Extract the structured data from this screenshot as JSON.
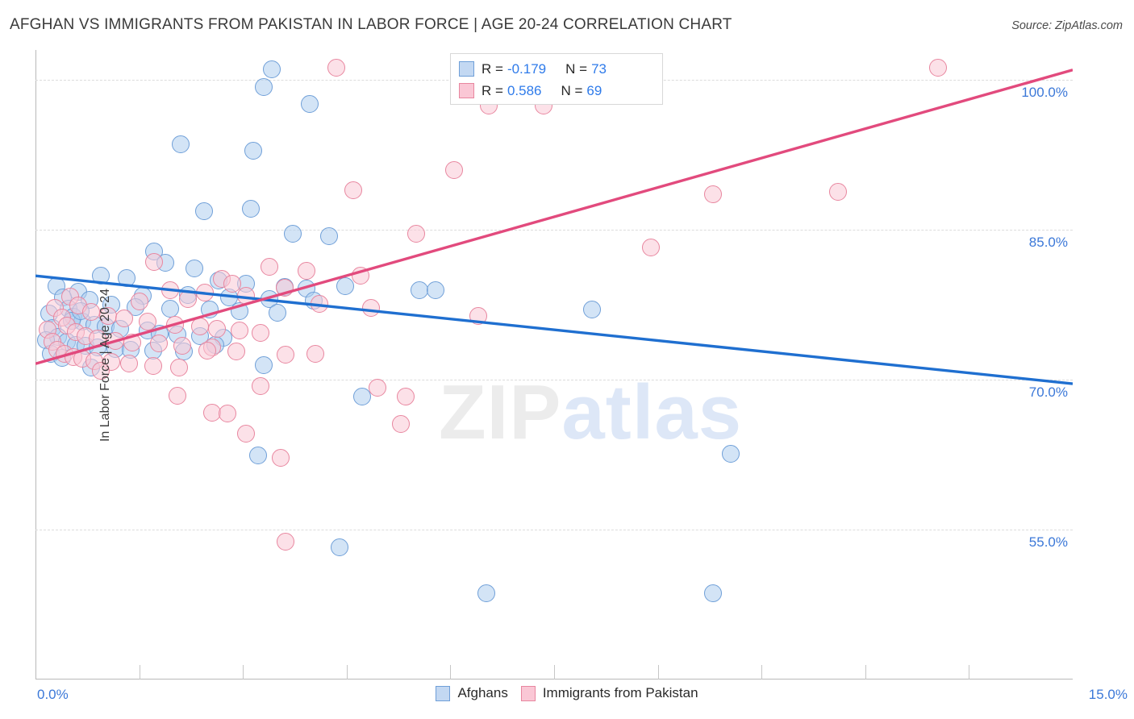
{
  "title": "AFGHAN VS IMMIGRANTS FROM PAKISTAN IN LABOR FORCE | AGE 20-24 CORRELATION CHART",
  "source": "Source: ZipAtlas.com",
  "watermark": {
    "part1": "ZIP",
    "part2": "atlas"
  },
  "colors": {
    "blue_fill": "#afcdee",
    "blue_stroke": "#6f9fd8",
    "pink_fill": "#f9c8d6",
    "pink_stroke": "#e8869f",
    "blue_line": "#1f6fd0",
    "pink_line": "#e24a7d",
    "axis_label": "#3b78d8",
    "grid": "#dcdcdc"
  },
  "stats": [
    {
      "series": "Afghans",
      "swatch": "blue",
      "r_label": "R =",
      "r_value": "-0.179",
      "n_label": "N =",
      "n_value": "73"
    },
    {
      "series": "Immigrants from Pakistan",
      "swatch": "pink",
      "r_label": "R =",
      "r_value": "0.586",
      "n_label": "N =",
      "n_value": "69"
    }
  ],
  "legend": [
    {
      "label": "Afghans",
      "swatch": "blue"
    },
    {
      "label": "Immigrants from Pakistan",
      "swatch": "pink"
    }
  ],
  "chart_data": {
    "type": "scatter",
    "title": "AFGHAN VS IMMIGRANTS FROM PAKISTAN IN LABOR FORCE | AGE 20-24 CORRELATION CHART",
    "xlabel": "",
    "ylabel": "In Labor Force | Age 20-24",
    "xlim": [
      0.0,
      15.0
    ],
    "ylim": [
      40.0,
      103.0
    ],
    "x_tick_labels": [
      "0.0%",
      "15.0%"
    ],
    "y_tick_labels": [
      "100.0%",
      "85.0%",
      "70.0%",
      "55.0%"
    ],
    "y_ticks": [
      100.0,
      85.0,
      70.0,
      55.0
    ],
    "x_ticks_count": 10,
    "grid": "horizontal-dashed",
    "legend_position": "bottom-center",
    "series": [
      {
        "name": "Afghans",
        "color": "#afcdee",
        "stroke": "#6f9fd8",
        "r": -0.179,
        "n": 73,
        "trendline": {
          "x0": 0.0,
          "y0": 80.4,
          "x1": 15.0,
          "y1": 69.6
        },
        "points": [
          [
            3.42,
            101.1
          ],
          [
            8.7,
            101.3
          ],
          [
            3.3,
            99.3
          ],
          [
            3.96,
            97.6
          ],
          [
            2.1,
            93.6
          ],
          [
            3.15,
            92.9
          ],
          [
            2.44,
            86.9
          ],
          [
            3.12,
            87.1
          ],
          [
            3.72,
            84.6
          ],
          [
            4.25,
            84.4
          ],
          [
            1.72,
            82.8
          ],
          [
            1.88,
            81.7
          ],
          [
            2.3,
            81.1
          ],
          [
            0.95,
            80.4
          ],
          [
            1.32,
            80.2
          ],
          [
            2.65,
            79.9
          ],
          [
            3.05,
            79.6
          ],
          [
            3.6,
            79.3
          ],
          [
            3.92,
            79.1
          ],
          [
            4.48,
            79.4
          ],
          [
            5.55,
            79.0
          ],
          [
            5.78,
            79.0
          ],
          [
            1.55,
            78.4
          ],
          [
            2.2,
            78.5
          ],
          [
            2.8,
            78.2
          ],
          [
            3.38,
            78.1
          ],
          [
            4.02,
            77.9
          ],
          [
            0.62,
            78.8
          ],
          [
            0.78,
            78.0
          ],
          [
            1.1,
            77.5
          ],
          [
            1.45,
            77.3
          ],
          [
            1.95,
            77.1
          ],
          [
            2.52,
            77.0
          ],
          [
            2.95,
            76.9
          ],
          [
            3.5,
            76.7
          ],
          [
            8.05,
            77.0
          ],
          [
            0.3,
            79.4
          ],
          [
            0.4,
            78.2
          ],
          [
            0.48,
            77.1
          ],
          [
            0.55,
            76.3
          ],
          [
            0.68,
            75.8
          ],
          [
            0.85,
            75.5
          ],
          [
            1.02,
            75.3
          ],
          [
            1.22,
            75.1
          ],
          [
            1.62,
            74.9
          ],
          [
            1.8,
            74.6
          ],
          [
            2.05,
            74.5
          ],
          [
            2.38,
            74.4
          ],
          [
            2.72,
            74.2
          ],
          [
            0.2,
            76.6
          ],
          [
            0.25,
            75.2
          ],
          [
            0.33,
            74.3
          ],
          [
            0.45,
            73.8
          ],
          [
            0.58,
            73.5
          ],
          [
            0.72,
            73.4
          ],
          [
            0.9,
            73.2
          ],
          [
            1.15,
            73.1
          ],
          [
            1.38,
            73.0
          ],
          [
            1.7,
            72.9
          ],
          [
            2.15,
            72.8
          ],
          [
            2.6,
            73.5
          ],
          [
            0.15,
            74.0
          ],
          [
            0.22,
            72.6
          ],
          [
            0.38,
            72.2
          ],
          [
            0.52,
            75.9
          ],
          [
            0.65,
            76.9
          ],
          [
            0.8,
            71.2
          ],
          [
            3.3,
            71.5
          ],
          [
            4.72,
            68.3
          ],
          [
            3.22,
            62.4
          ],
          [
            4.4,
            53.2
          ],
          [
            6.52,
            48.6
          ],
          [
            10.05,
            62.6
          ],
          [
            9.8,
            48.6
          ]
        ]
      },
      {
        "name": "Immigrants from Pakistan",
        "color": "#f9c8d6",
        "stroke": "#e8869f",
        "r": 0.586,
        "n": 69,
        "trendline": {
          "x0": 0.0,
          "y0": 71.6,
          "x1": 15.0,
          "y1": 101.0
        },
        "points": [
          [
            4.35,
            101.2
          ],
          [
            13.05,
            101.2
          ],
          [
            6.55,
            97.4
          ],
          [
            7.35,
            97.4
          ],
          [
            6.05,
            91.0
          ],
          [
            4.6,
            89.0
          ],
          [
            9.8,
            88.6
          ],
          [
            11.6,
            88.8
          ],
          [
            5.5,
            84.6
          ],
          [
            8.9,
            83.2
          ],
          [
            1.72,
            81.8
          ],
          [
            3.38,
            81.3
          ],
          [
            3.92,
            80.9
          ],
          [
            4.7,
            80.4
          ],
          [
            2.7,
            80.1
          ],
          [
            2.85,
            79.6
          ],
          [
            3.6,
            79.2
          ],
          [
            1.95,
            79.0
          ],
          [
            2.45,
            78.7
          ],
          [
            3.05,
            78.4
          ],
          [
            2.2,
            78.1
          ],
          [
            1.5,
            77.8
          ],
          [
            4.1,
            77.6
          ],
          [
            4.85,
            77.2
          ],
          [
            0.5,
            78.3
          ],
          [
            0.62,
            77.4
          ],
          [
            0.8,
            76.8
          ],
          [
            1.05,
            76.4
          ],
          [
            1.28,
            76.1
          ],
          [
            1.62,
            75.8
          ],
          [
            2.02,
            75.5
          ],
          [
            2.38,
            75.3
          ],
          [
            2.62,
            75.1
          ],
          [
            2.95,
            74.9
          ],
          [
            3.25,
            74.7
          ],
          [
            6.4,
            76.4
          ],
          [
            0.28,
            77.2
          ],
          [
            0.38,
            76.2
          ],
          [
            0.45,
            75.4
          ],
          [
            0.58,
            74.8
          ],
          [
            0.72,
            74.4
          ],
          [
            0.9,
            74.1
          ],
          [
            1.15,
            73.9
          ],
          [
            1.4,
            73.7
          ],
          [
            1.78,
            73.6
          ],
          [
            2.12,
            73.4
          ],
          [
            2.55,
            73.2
          ],
          [
            0.18,
            75.0
          ],
          [
            0.24,
            73.8
          ],
          [
            0.32,
            73.0
          ],
          [
            0.42,
            72.6
          ],
          [
            0.55,
            72.3
          ],
          [
            0.68,
            72.1
          ],
          [
            0.85,
            71.9
          ],
          [
            1.1,
            71.8
          ],
          [
            1.35,
            71.6
          ],
          [
            1.7,
            71.4
          ],
          [
            2.08,
            71.2
          ],
          [
            2.48,
            72.9
          ],
          [
            2.9,
            72.8
          ],
          [
            3.62,
            72.5
          ],
          [
            4.05,
            72.6
          ],
          [
            0.95,
            70.9
          ],
          [
            2.05,
            68.4
          ],
          [
            3.25,
            69.4
          ],
          [
            4.95,
            69.2
          ],
          [
            5.35,
            68.3
          ],
          [
            2.55,
            66.7
          ],
          [
            2.78,
            66.6
          ],
          [
            3.05,
            64.6
          ],
          [
            3.55,
            62.2
          ],
          [
            3.62,
            53.8
          ],
          [
            5.28,
            65.6
          ]
        ]
      }
    ]
  }
}
